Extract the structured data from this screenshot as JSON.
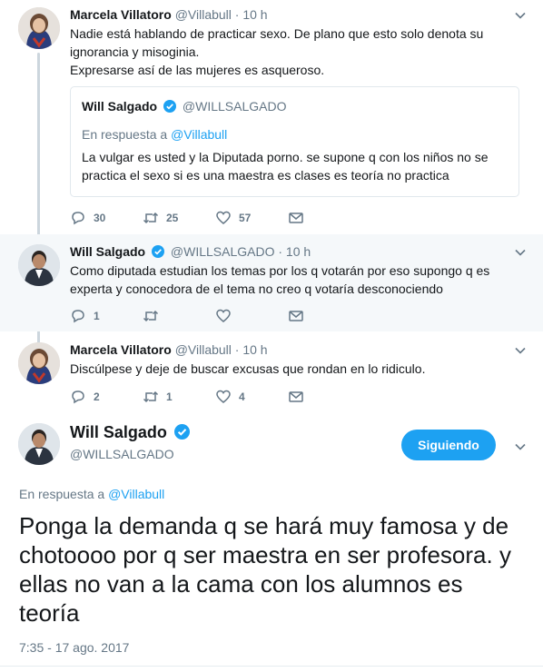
{
  "tweet1": {
    "name": "Marcela Villatoro",
    "handle": "@Villabull",
    "time": "· 10 h",
    "text": "Nadie está hablando de practicar sexo. De plano que esto solo denota su\nignorancia y misoginia.\nExpresarse así de las mujeres es asqueroso.",
    "quote": {
      "name": "Will Salgado",
      "handle": "@WILLSALGADO",
      "reply_prefix": "En respuesta a ",
      "reply_to": "@Villabull",
      "text": "La vulgar es usted y la Diputada porno. se supone q con los niños no se practica el sexo si es una maestra es clases es teoría no practica"
    },
    "replies": "30",
    "retweets": "25",
    "likes": "57"
  },
  "tweet2": {
    "name": "Will Salgado",
    "handle": "@WILLSALGADO",
    "time": "· 10 h",
    "text": "Como diputada estudian los temas por los q votarán por eso supongo q es\nexperta y conocedora de el tema no creo q votaría desconociendo",
    "replies": "1",
    "retweets": "",
    "likes": ""
  },
  "tweet3": {
    "name": "Marcela Villatoro",
    "handle": "@Villabull",
    "time": "· 10 h",
    "text": "Discúlpese y deje de buscar excusas que rondan en lo ridiculo.",
    "replies": "2",
    "retweets": "1",
    "likes": "4"
  },
  "focus": {
    "name": "Will Salgado",
    "handle": "@WILLSALGADO",
    "follow_label": "Siguiendo",
    "reply_prefix": "En respuesta a ",
    "reply_to": "@Villabull",
    "text": "Ponga la demanda q se hará muy famosa y de chotoooo por q ser maestra en ser profesora. y ellas no van a la cama con los alumnos es teoría",
    "timestamp": "7:35 - 17 ago. 2017"
  },
  "colors": {
    "accent": "#1da1f2",
    "muted": "#657786",
    "thread_line": "#ccd6dd"
  }
}
